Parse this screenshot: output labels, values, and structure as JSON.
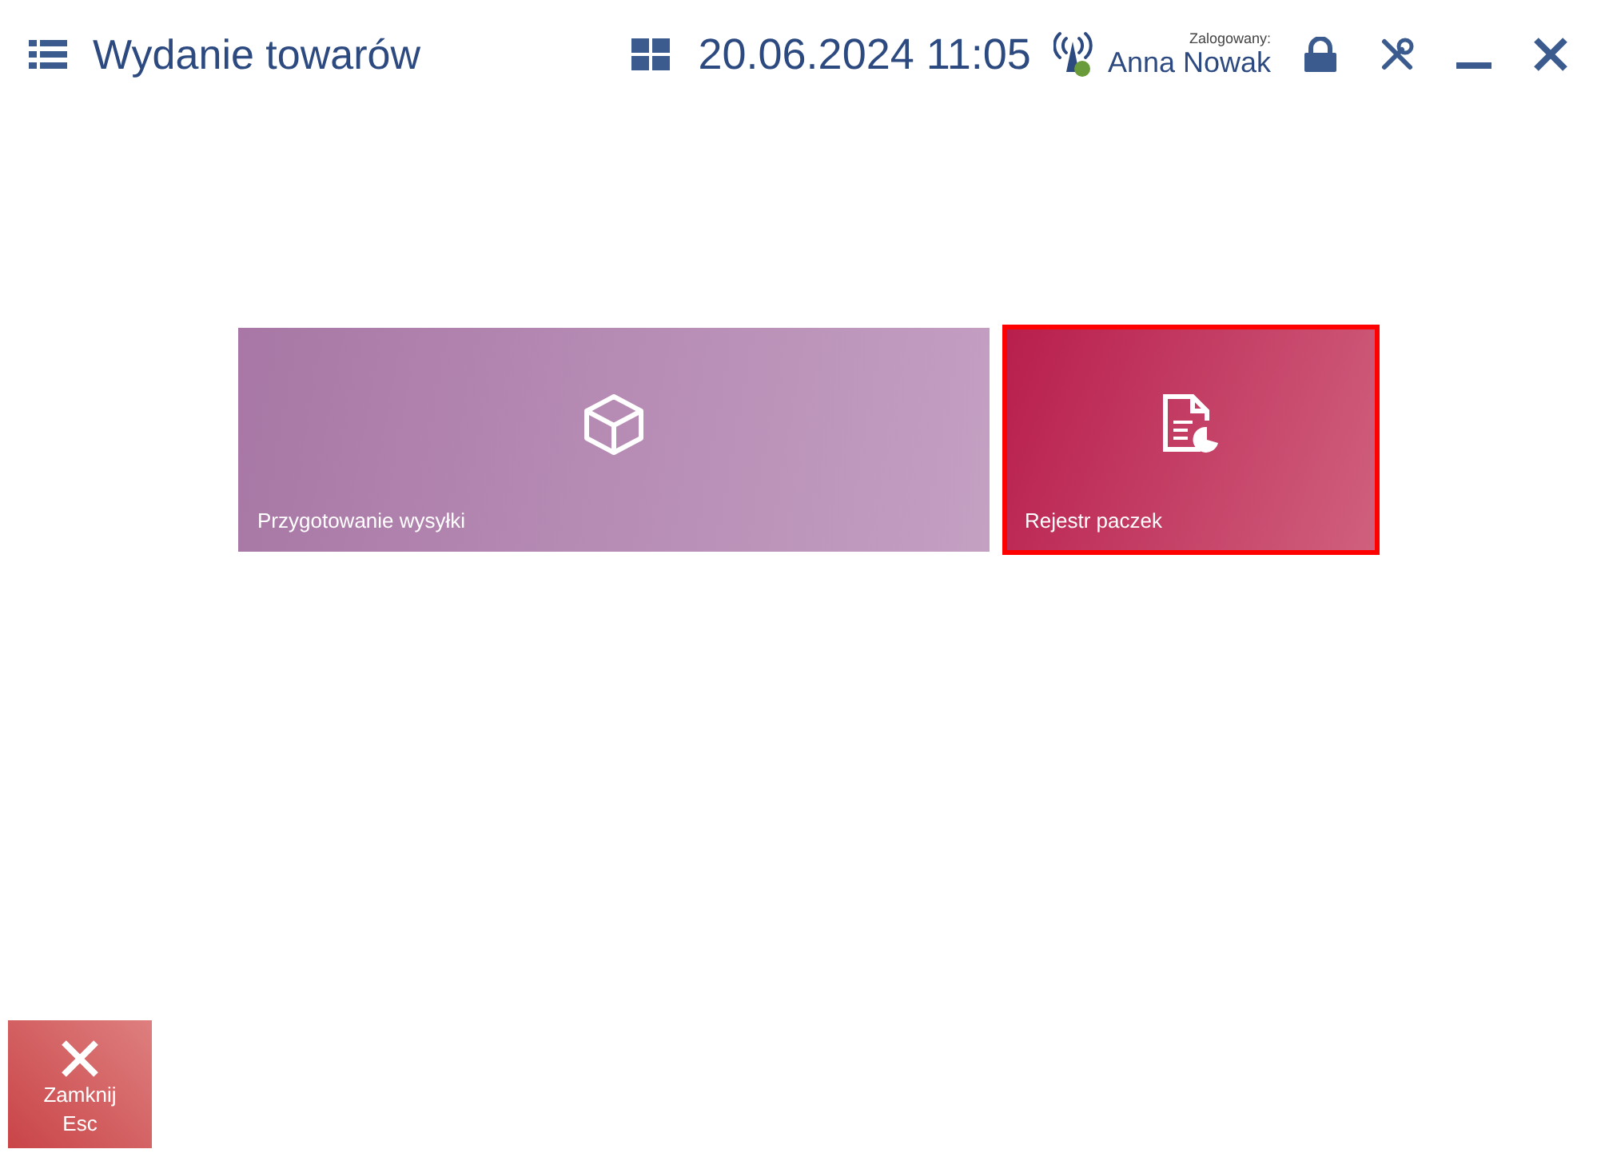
{
  "window": {
    "title": "Wydanie towarów"
  },
  "header": {
    "datetime": "20.06.2024 11:05",
    "logged_in_label": "Zalogowany:",
    "user": "Anna Nowak",
    "connected": true
  },
  "tiles": [
    {
      "kind": "box",
      "label": "Przygotowanie wysyłki",
      "selected": false
    },
    {
      "kind": "report",
      "label": "Rejestr paczek",
      "selected": true
    }
  ],
  "close_button": {
    "label": "Zamknij",
    "shortcut": "Esc"
  }
}
